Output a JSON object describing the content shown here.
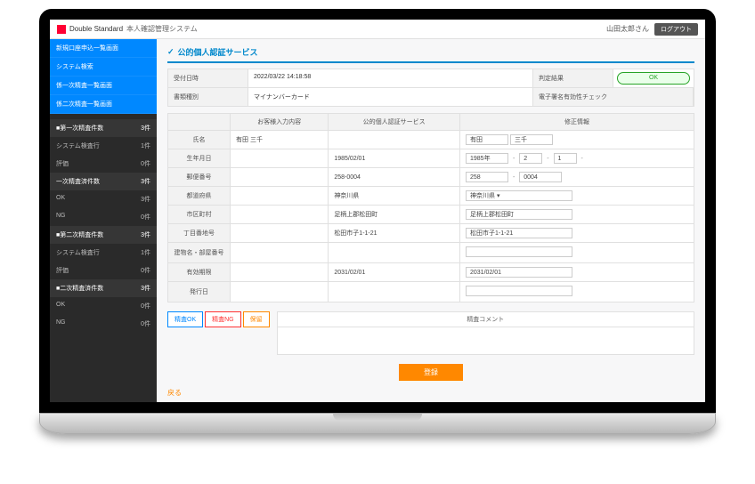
{
  "header": {
    "brand": "Double Standard",
    "system_name": "本人確認管理システム",
    "user_label": "山田太郎さん",
    "logout": "ログアウト"
  },
  "sidebar": {
    "items": [
      {
        "label": "新規口座申込一覧画面",
        "kind": "active"
      },
      {
        "label": "システム検索",
        "kind": "blue"
      },
      {
        "label": "係一次精査一覧画面",
        "kind": "blue"
      },
      {
        "label": "係二次精査一覧画面",
        "kind": "blue"
      }
    ],
    "groups": [
      {
        "head": "■第一次精査件数",
        "head_count": "3件",
        "rows": [
          {
            "label": "システム検査行",
            "count": "1件"
          },
          {
            "label": "評価",
            "count": "0件"
          }
        ]
      },
      {
        "head": "一次精査済件数",
        "head_count": "3件",
        "rows": [
          {
            "label": "OK",
            "count": "3件"
          },
          {
            "label": "NG",
            "count": "0件"
          }
        ]
      },
      {
        "head": "■第二次精査件数",
        "head_count": "3件",
        "rows": [
          {
            "label": "システム検査行",
            "count": "1件"
          },
          {
            "label": "評価",
            "count": "0件"
          }
        ]
      },
      {
        "head": "■二次精査済件数",
        "head_count": "3件",
        "rows": [
          {
            "label": "OK",
            "count": "0件"
          },
          {
            "label": "NG",
            "count": "0件"
          }
        ]
      }
    ]
  },
  "page": {
    "title": "公的個人認証サービス",
    "info": [
      {
        "label": "受付日時",
        "value": "2022/03/22 14:18:58",
        "right_label": "判定結果",
        "right_value": "OK"
      },
      {
        "label": "書類種別",
        "value": "マイナンバーカード",
        "right_label": "電子署名有効性チェック",
        "right_value": ""
      }
    ],
    "cmp_headers": {
      "c1": "お客様入力内容",
      "c2": "公的個人認証サービス",
      "c3": "修正情報"
    },
    "rows": {
      "name": {
        "label": "氏名",
        "c1": "有田 三千",
        "c2": "",
        "c3_a": "有田",
        "c3_b": "三千"
      },
      "dob": {
        "label": "生年月日",
        "c1": "",
        "c2": "1985/02/01",
        "c3_year": "1985年",
        "c3_m": "2",
        "c3_d": "1"
      },
      "zip": {
        "label": "郵便番号",
        "c1": "",
        "c2": "258-0004",
        "c3_a": "258",
        "c3_b": "0004"
      },
      "pref": {
        "label": "都道府県",
        "c1": "",
        "c2": "神奈川県",
        "c3": "神奈川県 ▾"
      },
      "city": {
        "label": "市区町村",
        "c1": "",
        "c2": "足柄上郡松田町",
        "c3": "足柄上郡松田町"
      },
      "addr": {
        "label": "丁目番地号",
        "c1": "",
        "c2": "松田市子1-1-21",
        "c3": "松田市子1-1-21"
      },
      "bldg": {
        "label": "建物名・部屋番号",
        "c1": "",
        "c2": "",
        "c3": ""
      },
      "valid": {
        "label": "有効期限",
        "c1": "",
        "c2": "2031/02/01",
        "c3": "2031/02/01"
      },
      "issue": {
        "label": "発行日",
        "c1": "",
        "c2": "",
        "c3": ""
      }
    },
    "actions": {
      "ok": "精査OK",
      "ng": "精査NG",
      "hold": "保留",
      "comment_label": "精査コメント",
      "submit": "登録",
      "back": "戻る"
    }
  }
}
